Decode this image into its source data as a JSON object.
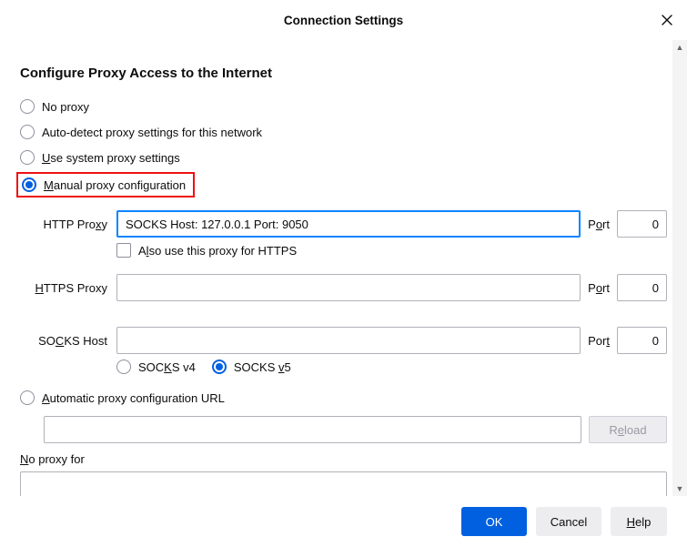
{
  "dialog": {
    "title": "Connection Settings"
  },
  "section": {
    "heading": "Configure Proxy Access to the Internet"
  },
  "modes": {
    "none": "No proxy",
    "auto": "Auto-detect proxy settings for this network",
    "system_prefix": "U",
    "system_rest": "se system proxy settings",
    "manual_prefix": "M",
    "manual_rest": "anual proxy configuration",
    "pac_prefix": "A",
    "pac_rest": "utomatic proxy configuration URL"
  },
  "http": {
    "label_prefix": "HTTP Pro",
    "label_u": "x",
    "label_suffix": "y",
    "value": "SOCKS Host: 127.0.0.1 Port: 9050",
    "port_prefix": "P",
    "port_u": "o",
    "port_suffix": "rt",
    "port_value": "0",
    "also_prefix": "A",
    "also_u": "l",
    "also_suffix": "so use this proxy for HTTPS"
  },
  "https": {
    "label_u": "H",
    "label_rest": "TTPS Proxy",
    "value": "",
    "port_prefix": "P",
    "port_u": "o",
    "port_suffix": "rt",
    "port_value": "0"
  },
  "socks": {
    "label_prefix": "SO",
    "label_u": "C",
    "label_suffix": "KS Host",
    "value": "",
    "port_prefix": "Por",
    "port_u": "t",
    "port_suffix": "",
    "port_value": "0",
    "v4_prefix": "SOC",
    "v4_u": "K",
    "v4_suffix": "S v4",
    "v5_prefix": "SOCKS ",
    "v5_u": "v",
    "v5_suffix": "5"
  },
  "pac": {
    "url": "",
    "reload_prefix": "R",
    "reload_u": "e",
    "reload_suffix": "load"
  },
  "noproxy": {
    "label_u": "N",
    "label_rest": "o proxy for",
    "value": ""
  },
  "buttons": {
    "ok": "OK",
    "cancel": "Cancel",
    "help_u": "H",
    "help_rest": "elp"
  }
}
